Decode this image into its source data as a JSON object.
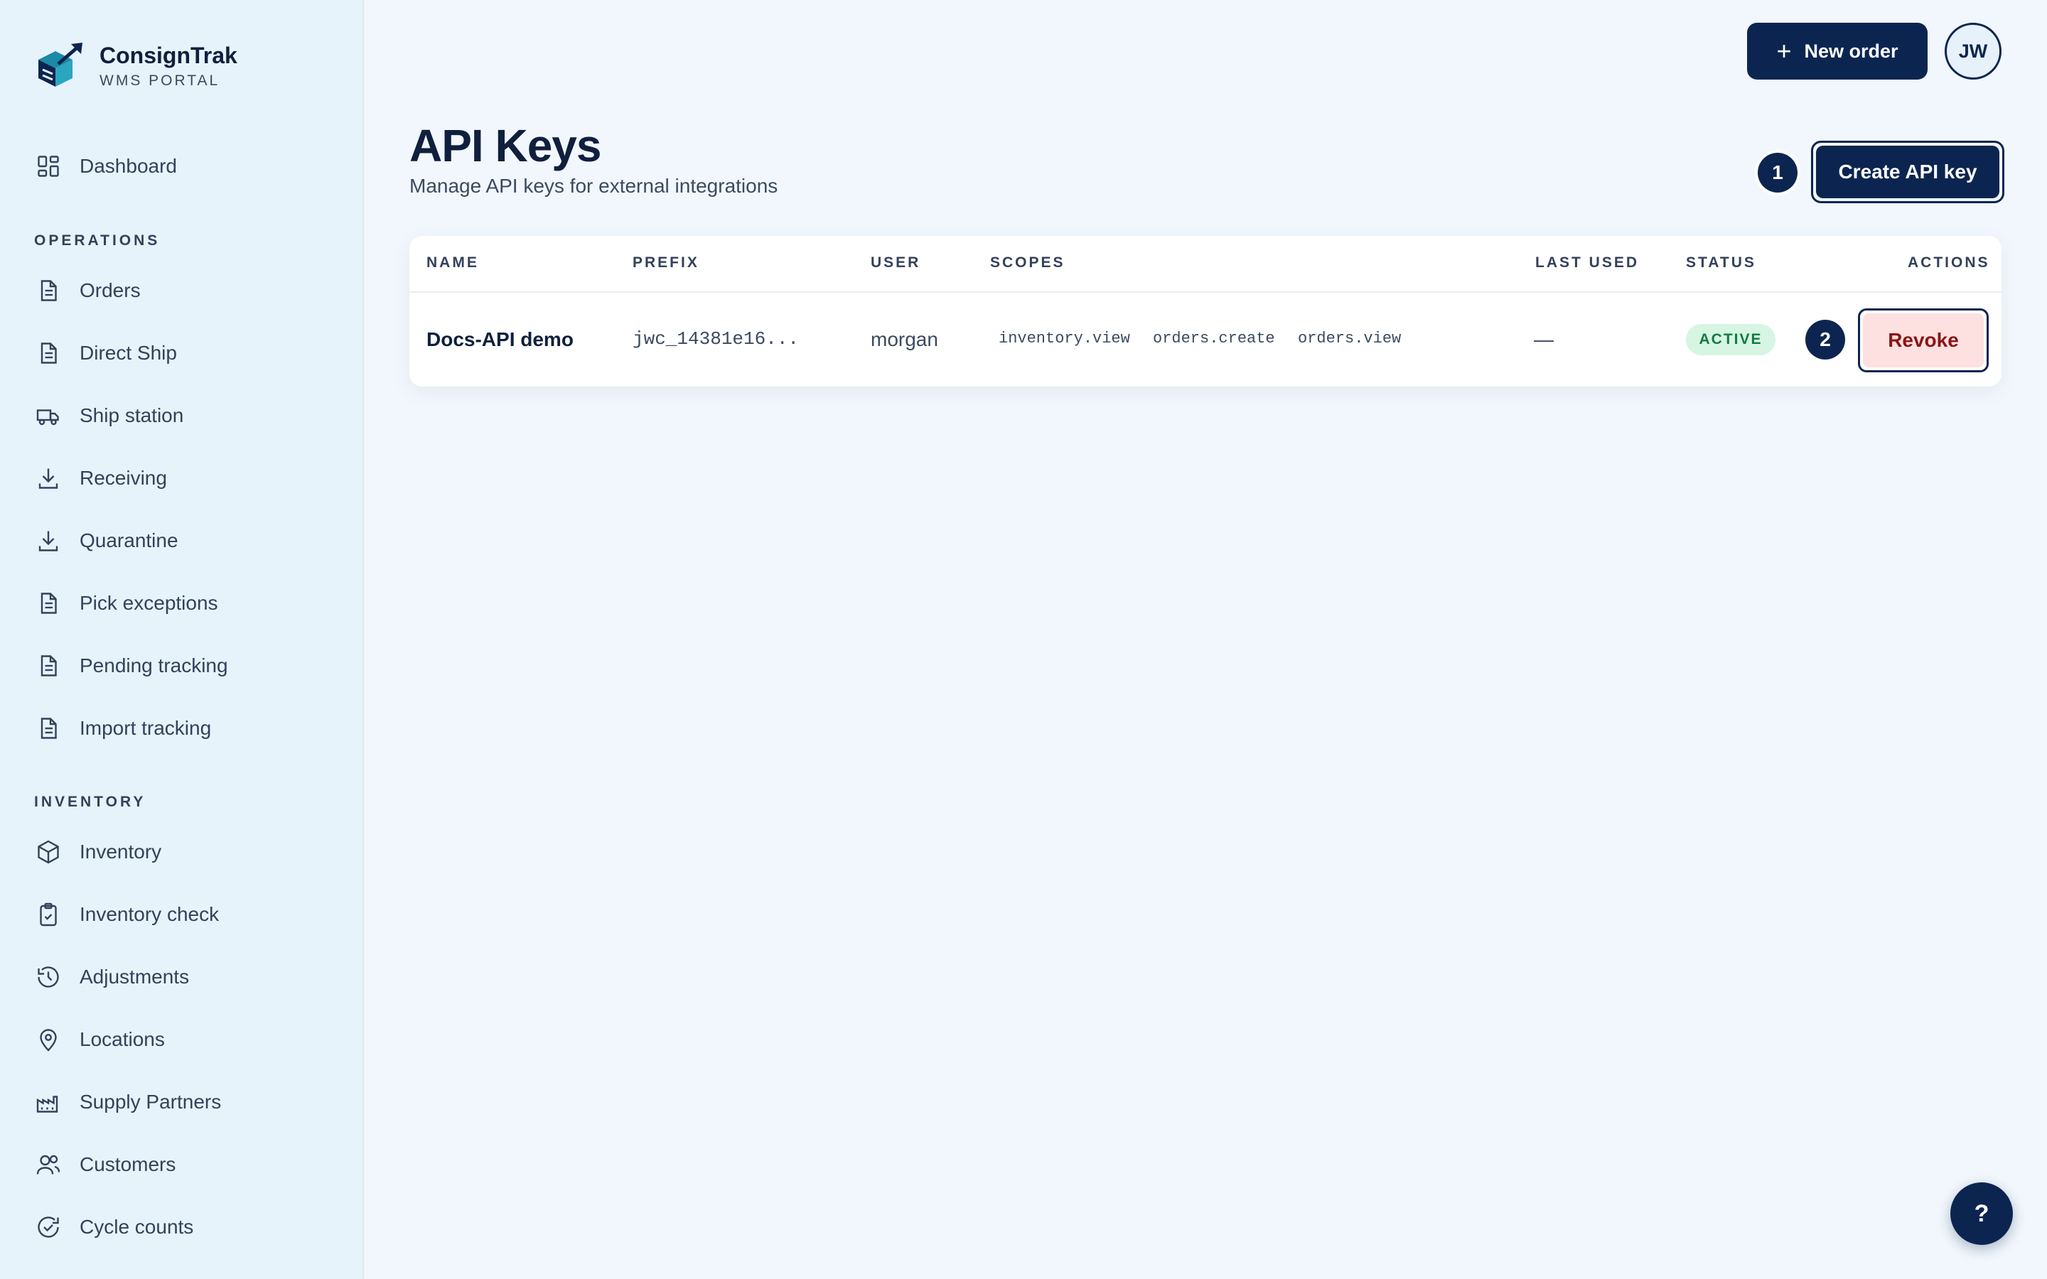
{
  "brand": {
    "name": "ConsignTrak",
    "subtitle": "WMS PORTAL",
    "accent_colors": [
      "#1a8aa6",
      "#0c2550"
    ]
  },
  "sidebar": {
    "dashboard": {
      "label": "Dashboard",
      "icon": "dashboard-icon"
    },
    "sections": [
      {
        "title": "OPERATIONS",
        "items": [
          {
            "label": "Orders",
            "icon": "document-icon"
          },
          {
            "label": "Direct Ship",
            "icon": "document-icon"
          },
          {
            "label": "Ship station",
            "icon": "truck-icon"
          },
          {
            "label": "Receiving",
            "icon": "download-icon"
          },
          {
            "label": "Quarantine",
            "icon": "download-icon"
          },
          {
            "label": "Pick exceptions",
            "icon": "document-icon"
          },
          {
            "label": "Pending tracking",
            "icon": "document-icon"
          },
          {
            "label": "Import tracking",
            "icon": "document-icon"
          }
        ]
      },
      {
        "title": "INVENTORY",
        "items": [
          {
            "label": "Inventory",
            "icon": "box-icon"
          },
          {
            "label": "Inventory check",
            "icon": "clipboard-check-icon"
          },
          {
            "label": "Adjustments",
            "icon": "history-icon"
          },
          {
            "label": "Locations",
            "icon": "map-pin-icon"
          },
          {
            "label": "Supply Partners",
            "icon": "factory-icon"
          },
          {
            "label": "Customers",
            "icon": "users-icon"
          },
          {
            "label": "Cycle counts",
            "icon": "refresh-check-icon"
          }
        ]
      }
    ]
  },
  "topbar": {
    "new_order_label": "New order",
    "avatar_initials": "JW"
  },
  "page": {
    "title": "API Keys",
    "subtitle": "Manage API keys for external integrations",
    "create_button_label": "Create API key",
    "step_1": "1",
    "step_2": "2"
  },
  "table": {
    "headers": {
      "name": "NAME",
      "prefix": "PREFIX",
      "user": "USER",
      "scopes": "SCOPES",
      "last_used": "LAST USED",
      "status": "STATUS",
      "actions": "ACTIONS"
    },
    "rows": [
      {
        "name": "Docs-API demo",
        "prefix": "jwc_14381e16...",
        "user": "morgan",
        "scopes": [
          "inventory.view",
          "orders.create",
          "orders.view"
        ],
        "last_used": "—",
        "status": "ACTIVE",
        "action_label": "Revoke"
      }
    ]
  },
  "help": {
    "label": "?"
  },
  "colors": {
    "primary": "#0c2550",
    "status_active_bg": "#d6f5e3",
    "status_active_text": "#137a44",
    "revoke_bg": "#fde0e0",
    "revoke_text": "#8a1515"
  }
}
